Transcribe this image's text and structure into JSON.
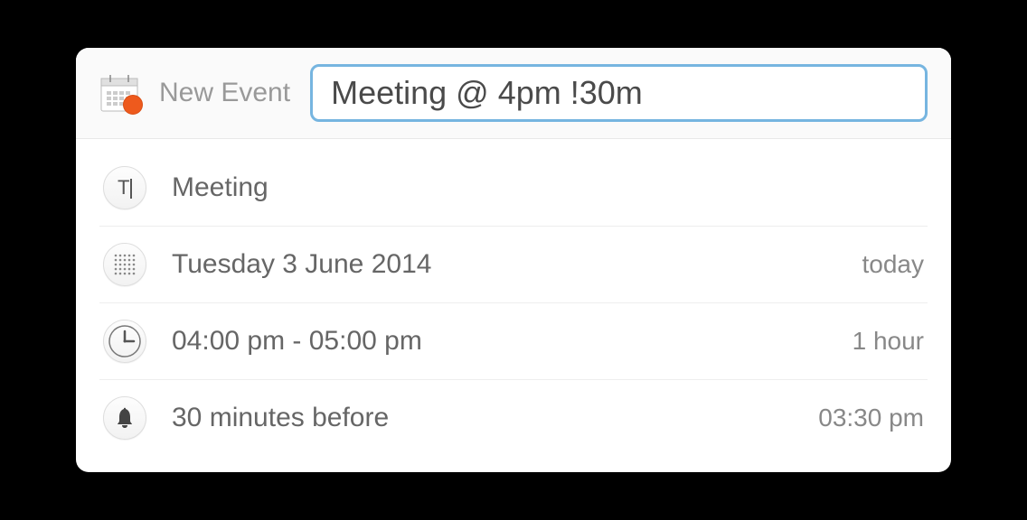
{
  "header": {
    "label": "New Event",
    "input_value": "Meeting @ 4pm !30m"
  },
  "details": {
    "title": {
      "text": "Meeting"
    },
    "date": {
      "text": "Tuesday 3 June 2014",
      "relative": "today"
    },
    "time": {
      "range": "04:00 pm - 05:00 pm",
      "duration": "1 hour"
    },
    "reminder": {
      "text": "30 minutes before",
      "at": "03:30 pm"
    }
  }
}
